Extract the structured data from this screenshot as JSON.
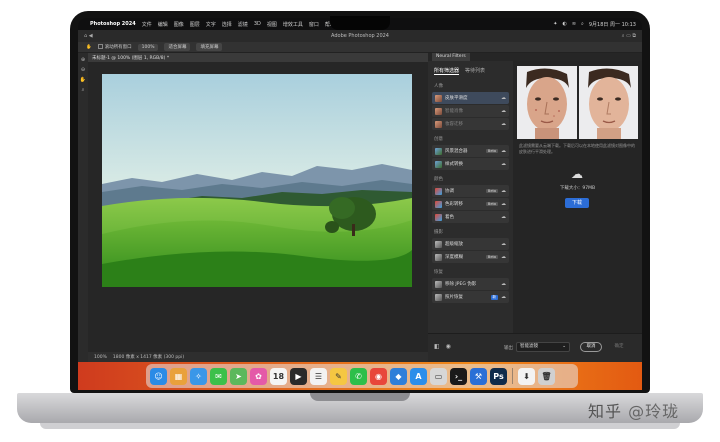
{
  "menubar": {
    "app_name": "Photoshop 2024",
    "menus": [
      "文件",
      "编辑",
      "图像",
      "图层",
      "文字",
      "选择",
      "滤镜",
      "3D",
      "视图",
      "增效工具",
      "窗口",
      "帮助"
    ],
    "right_items": [
      "✦",
      "◐",
      "≋",
      "⌕",
      "9月18日 周一 10:13"
    ]
  },
  "titlebar": {
    "title": "Adobe Photoshop 2024",
    "left_icons": "⌂  ◀",
    "right_icons": "⌕  ▭  ⧉"
  },
  "optbar": {
    "scroll_all": "滚动所有窗口",
    "zoom": "100%",
    "fit_screen": "适合屏幕",
    "fill_screen": "填充屏幕"
  },
  "document": {
    "tab": "未标题-1 @ 100% (图层 1, RGB/8) *",
    "status_zoom": "100%",
    "status_info": "1800 像素 x 1417 像素 (300 ppi)"
  },
  "neural_filters": {
    "panel_title": "Neural Filters",
    "tabs": [
      "所有筛选器",
      "等待列表"
    ],
    "groups": [
      {
        "label": "人像",
        "items": [
          {
            "label": "皮肤平滑度",
            "state": "selected",
            "thumb": "face",
            "badge": ""
          },
          {
            "label": "智能肖像",
            "state": "dim",
            "thumb": "face",
            "badge": ""
          },
          {
            "label": "妆容迁移",
            "state": "dim",
            "thumb": "face",
            "badge": ""
          }
        ]
      },
      {
        "label": "创意",
        "items": [
          {
            "label": "风景混合器",
            "state": "normal",
            "thumb": "land",
            "badge": "Beta"
          },
          {
            "label": "样式转换",
            "state": "normal",
            "thumb": "land",
            "badge": ""
          }
        ]
      },
      {
        "label": "颜色",
        "items": [
          {
            "label": "协调",
            "state": "normal",
            "thumb": "color",
            "badge": "Beta"
          },
          {
            "label": "色彩转移",
            "state": "normal",
            "thumb": "color",
            "badge": "Beta"
          },
          {
            "label": "着色",
            "state": "normal",
            "thumb": "color",
            "badge": ""
          }
        ]
      },
      {
        "label": "摄影",
        "items": [
          {
            "label": "超级缩放",
            "state": "normal",
            "thumb": "photo2",
            "badge": ""
          },
          {
            "label": "深度模糊",
            "state": "normal",
            "thumb": "photo2",
            "badge": "Beta"
          }
        ]
      },
      {
        "label": "恢复",
        "items": [
          {
            "label": "移除 JPEG 伪影",
            "state": "normal",
            "thumb": "photo2",
            "badge": ""
          },
          {
            "label": "照片恢复",
            "state": "normal",
            "thumb": "photo2",
            "badge": "新"
          }
        ]
      }
    ]
  },
  "preview": {
    "description": "此滤镜需要从云端下载。下载后可以在本地使用此滤镜对图像中的皮肤进行平滑处理。",
    "download_size": "下载大小：97MB",
    "download_button": "下载"
  },
  "actions": {
    "output_label": "输出",
    "output_value": "智能滤镜",
    "cancel": "取消",
    "ok": "确定"
  },
  "dock": {
    "apps": [
      {
        "name": "finder-icon",
        "glyph": "☺",
        "color": "#2b8be6"
      },
      {
        "name": "launchpad-icon",
        "glyph": "▦",
        "color": "#e9a13b"
      },
      {
        "name": "safari-icon",
        "glyph": "✧",
        "color": "#3a97e8"
      },
      {
        "name": "messages-icon",
        "glyph": "✉",
        "color": "#3cc04a"
      },
      {
        "name": "maps-icon",
        "glyph": "➤",
        "color": "#5bb85c"
      },
      {
        "name": "photos-icon",
        "glyph": "✿",
        "color": "#e45aa8"
      },
      {
        "name": "calendar-icon",
        "glyph": "18",
        "color": "#f4f4f4"
      },
      {
        "name": "final-cut-icon",
        "glyph": "▶",
        "color": "#2a2a2a"
      },
      {
        "name": "reminders-icon",
        "glyph": "☰",
        "color": "#f2f2f2"
      },
      {
        "name": "notes-icon",
        "glyph": "✎",
        "color": "#f5c742"
      },
      {
        "name": "wechat-icon",
        "glyph": "✆",
        "color": "#2dbf4a"
      },
      {
        "name": "chrome-icon",
        "glyph": "◉",
        "color": "#e8463a"
      },
      {
        "name": "keynote-icon",
        "glyph": "◆",
        "color": "#2f7fd9"
      },
      {
        "name": "appstore-icon",
        "glyph": "A",
        "color": "#2c8eea"
      },
      {
        "name": "preview-icon",
        "glyph": "▭",
        "color": "#d7d7d7"
      },
      {
        "name": "terminal-icon",
        "glyph": "›_",
        "color": "#1a1a1a"
      },
      {
        "name": "xcode-icon",
        "glyph": "⚒",
        "color": "#2a6fd6"
      },
      {
        "name": "photoshop-icon",
        "glyph": "Ps",
        "color": "#0f2b4a"
      }
    ],
    "trailing": [
      {
        "name": "downloads-icon",
        "glyph": "⬇",
        "color": "#f3f3f3"
      },
      {
        "name": "trash-icon",
        "glyph": "🗑",
        "color": "#d0d0d0"
      }
    ]
  },
  "watermark": {
    "site": "知乎",
    "handle": "@玲珑"
  }
}
